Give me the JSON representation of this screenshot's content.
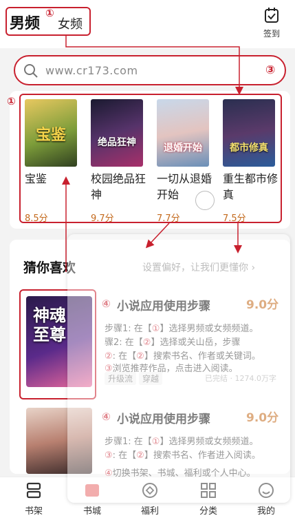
{
  "header": {
    "tab_male": "男频",
    "tab_female": "女频",
    "checkin_label": "签到"
  },
  "search": {
    "placeholder": "www.cr173.com"
  },
  "annotations": {
    "c1": "①",
    "c2": "①",
    "c3": "③",
    "c4": "④",
    "c5": "④"
  },
  "books": [
    {
      "title": "宝鉴",
      "score": "8.5分",
      "cover_text": "宝鉴",
      "color": "#c9a64a"
    },
    {
      "title": "校园绝品狂神",
      "score": "9.7分",
      "cover_text": "绝品狂神",
      "color": "#3a3d6a"
    },
    {
      "title": "一切从退婚开始",
      "score": "7.7分",
      "cover_text": "退婚开始",
      "color": "#7fa6c8"
    },
    {
      "title": "重生都市修真",
      "score": "7.5分",
      "cover_text": "都市修真",
      "color": "#2f4f86"
    }
  ],
  "guess": {
    "title": "猜你喜欢",
    "hint": "设置偏好，让我们更懂你"
  },
  "items": [
    {
      "title": "小说应用使用步骤",
      "score": "9.0分",
      "cover_text": "神魂至尊",
      "step1_a": "步骤1: 在【",
      "step1_b": "①",
      "step1_c": "】选择男频或女频频道。",
      "step2_a": "骤2: 在【",
      "step2_b": "②",
      "step2_c": "】选择或关山岳，步骤",
      "step3_a": "②",
      "step3_b": ": 在【",
      "step3_c": "②",
      "step3_d": "】搜索书名、作者或关键词。",
      "step4_a": "③",
      "step4_b": "浏览推荐作品，点击进入阅读。",
      "tag1": "升级流",
      "tag2": "穿越",
      "status": "已完结 · 1274.0万字"
    },
    {
      "title": "小说应用使用步骤",
      "score": "9.0分",
      "cover_text": "",
      "step1_a": "步骤1: 在【",
      "step1_b": "①",
      "step1_c": "】选择男频或女频频道。",
      "step2_a": "③",
      "step2_b": ": 在【",
      "step2_c": "②",
      "step2_d": "】搜索书名、作者进入阅读。",
      "step3_a": "④",
      "step3_b": "切换书架、书城、福利或个人中心。"
    }
  ],
  "nav": [
    {
      "label": "书架"
    },
    {
      "label": "书城"
    },
    {
      "label": "福利"
    },
    {
      "label": "分类"
    },
    {
      "label": "我的"
    }
  ],
  "colors": {
    "accent": "#c8202e",
    "score": "#c46a1d"
  }
}
